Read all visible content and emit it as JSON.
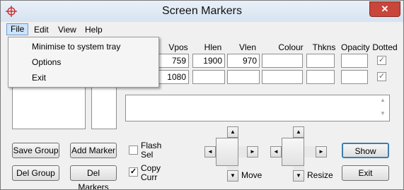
{
  "window": {
    "title": "Screen Markers",
    "close_symbol": "✕"
  },
  "menubar": {
    "items": [
      "File",
      "Edit",
      "View",
      "Help"
    ]
  },
  "file_menu": {
    "items": [
      "Minimise to system tray",
      "Options",
      "Exit"
    ]
  },
  "table": {
    "headers": [
      "Vpos",
      "Hlen",
      "Vlen",
      "Colour",
      "Thkns",
      "Opacity",
      "Dotted"
    ],
    "rows": [
      {
        "vpos": "759",
        "hlen": "1900",
        "vlen": "970",
        "colour": "",
        "thkns": "",
        "opacity": "",
        "dotted": "✓"
      },
      {
        "vpos": "1080",
        "hlen": "",
        "vlen": "",
        "colour": "",
        "thkns": "",
        "opacity": "",
        "dotted": "✓"
      }
    ]
  },
  "buttons": {
    "save_group": "Save Group",
    "add_marker": "Add Marker",
    "del_group": "Del Group",
    "del_markers": "Del Markers",
    "show": "Show",
    "exit": "Exit"
  },
  "checkboxes": {
    "flash_sel": {
      "label_line1": "Flash",
      "label_line2": "Sel",
      "checked": false
    },
    "copy_curr": {
      "label_line1": "Copy",
      "label_line2": "Curr",
      "checked": true,
      "mark": "✓"
    }
  },
  "move": {
    "label": "Move"
  },
  "resize": {
    "label": "Resize"
  },
  "icons": {
    "up": "▲",
    "down": "▼",
    "left": "◄",
    "right": "►"
  },
  "colors": {
    "title_bar": "#dae6f3",
    "close": "#c8463a",
    "default_button_border": "#3c7fb1"
  }
}
